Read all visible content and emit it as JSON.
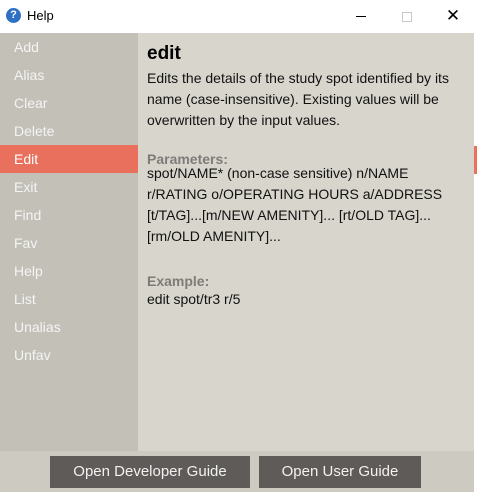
{
  "window": {
    "title": "Help",
    "app_icon": "question-mark-icon",
    "close_glyph": "✕"
  },
  "sidebar": {
    "items": [
      {
        "label": "Add"
      },
      {
        "label": "Alias"
      },
      {
        "label": "Clear"
      },
      {
        "label": "Delete"
      },
      {
        "label": "Edit",
        "selected": true
      },
      {
        "label": "Exit"
      },
      {
        "label": "Find"
      },
      {
        "label": "Fav"
      },
      {
        "label": "Help"
      },
      {
        "label": "List"
      },
      {
        "label": "Unalias"
      },
      {
        "label": "Unfav"
      }
    ]
  },
  "detail": {
    "command": "edit",
    "description": "Edits the details of the study spot identified by its name (case-insensitive). Existing values will be overwritten by the input values.",
    "parameters_label": "Parameters:",
    "parameters": "spot/NAME* (non-case sensitive) n/NAME r/RATING o/OPERATING HOURS a/ADDRESS [t/TAG]...[m/NEW AMENITY]... [rt/OLD TAG]... [rm/OLD AMENITY]...",
    "example_label": "Example:",
    "example": "edit spot/tr3 r/5"
  },
  "footer": {
    "developer_guide": "Open Developer Guide",
    "user_guide": "Open User Guide"
  },
  "colors": {
    "accent": "#e8705d",
    "sidebar_bg": "#c3c0b7",
    "detail_bg": "#d8d5cc",
    "button_bg": "#5e5b58"
  }
}
